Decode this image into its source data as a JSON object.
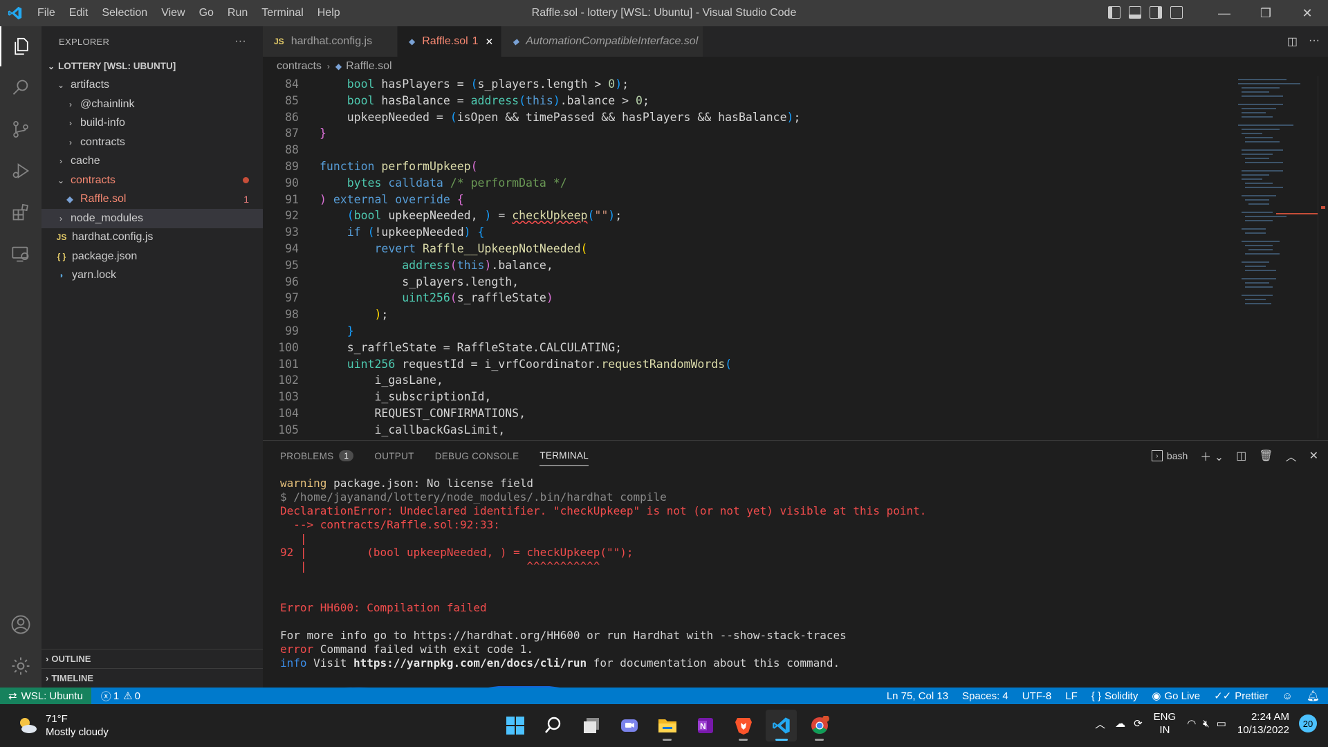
{
  "window": {
    "title": "Raffle.sol - lottery [WSL: Ubuntu] - Visual Studio Code",
    "menu": [
      "File",
      "Edit",
      "Selection",
      "View",
      "Go",
      "Run",
      "Terminal",
      "Help"
    ],
    "controls": {
      "minimize": "—",
      "restore": "❐",
      "close": "✕"
    }
  },
  "explorer": {
    "title": "EXPLORER",
    "more": "···",
    "root": "LOTTERY [WSL: UBUNTU]",
    "items": [
      {
        "label": "artifacts",
        "type": "folder-open"
      },
      {
        "label": "@chainlink",
        "type": "folder"
      },
      {
        "label": "build-info",
        "type": "folder"
      },
      {
        "label": "contracts",
        "type": "folder"
      },
      {
        "label": "cache",
        "type": "folder"
      },
      {
        "label": "contracts",
        "type": "folder-open"
      },
      {
        "label": "Raffle.sol",
        "type": "file",
        "badge": "1"
      },
      {
        "label": "node_modules",
        "type": "folder"
      },
      {
        "label": "hardhat.config.js",
        "type": "file",
        "icon": "JS"
      },
      {
        "label": "package.json",
        "type": "file",
        "icon": "{ }"
      },
      {
        "label": "yarn.lock",
        "type": "file"
      }
    ],
    "outline": "OUTLINE",
    "timeline": "TIMELINE"
  },
  "tabs": [
    {
      "label": "hardhat.config.js",
      "icon": "JS"
    },
    {
      "label": "Raffle.sol",
      "badge": "1",
      "close": "✕"
    },
    {
      "label": "AutomationCompatibleInterface.sol"
    }
  ],
  "breadcrumb": [
    "contracts",
    "Raffle.sol"
  ],
  "code": {
    "line_numbers": [
      "84",
      "85",
      "86",
      "87",
      "88",
      "89",
      "90",
      "91",
      "92",
      "93",
      "94",
      "95",
      "96",
      "97",
      "98",
      "99",
      "100",
      "101",
      "102",
      "103",
      "104",
      "105"
    ]
  },
  "panel": {
    "tabs": [
      "PROBLEMS",
      "OUTPUT",
      "DEBUG CONSOLE",
      "TERMINAL"
    ],
    "problems_count": "1",
    "shell": "bash",
    "terminal": [
      {
        "cls": "mix1",
        "a": "warning",
        "b": " package.json: No license field"
      },
      {
        "cls": "t-dim",
        "a": "$ /home/jayanand/lottery/node_modules/.bin/hardhat compile"
      },
      {
        "cls": "t-err",
        "a": "DeclarationError: Undeclared identifier. \"checkUpkeep\" is not (or not yet) visible at this point."
      },
      {
        "cls": "t-err",
        "a": "  --> contracts/Raffle.sol:92:33:"
      },
      {
        "cls": "t-err",
        "a": "   |"
      },
      {
        "cls": "t-err",
        "a": "92 |         (bool upkeepNeeded, ) = checkUpkeep(\"\");"
      },
      {
        "cls": "t-err",
        "a": "   |                                 ^^^^^^^^^^^"
      },
      {
        "cls": "t-err",
        "a": "Error HH600: Compilation failed"
      },
      {
        "cls": "t-txt",
        "a": "For more info go to https://hardhat.org/HH600 or run Hardhat with --show-stack-traces"
      },
      {
        "cls": "mix2",
        "a": "error",
        "b": " Command failed with exit code 1."
      },
      {
        "cls": "mix3",
        "a": "info",
        "b": " Visit ",
        "c": "https://yarnpkg.com/en/docs/cli/run",
        "d": " for documentation about this command."
      }
    ]
  },
  "statusbar": {
    "remote": "WSL: Ubuntu",
    "errors": "1",
    "warnings": "0",
    "position": "Ln 75, Col 13",
    "spaces": "Spaces: 4",
    "encoding": "UTF-8",
    "eol": "LF",
    "language": "Solidity",
    "golive": "Go Live",
    "prettier": "Prettier"
  },
  "taskbar": {
    "weather_temp": "71°F",
    "weather_desc": "Mostly cloudy",
    "lang1": "ENG",
    "lang2": "IN",
    "time": "2:24 AM",
    "date": "10/13/2022",
    "notifications": "20"
  },
  "colors": {
    "accent": "#007acc",
    "remote": "#16825d",
    "error": "#f14c4c"
  }
}
